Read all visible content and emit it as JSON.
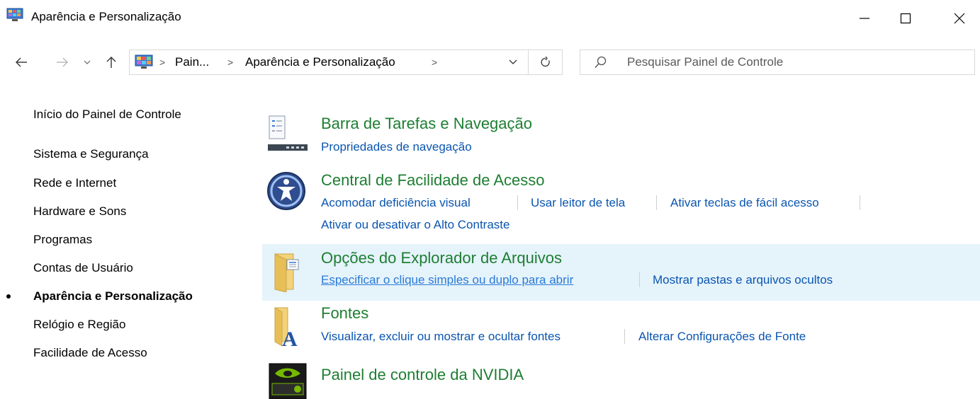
{
  "window": {
    "title": "Aparência e Personalização",
    "controls": [
      "minimize",
      "maximize",
      "close"
    ]
  },
  "navigation": {
    "breadcrumbs": [
      "Pain...",
      "Aparência e Personalização"
    ],
    "search_placeholder": "Pesquisar Painel de Controle",
    "search_value": ""
  },
  "sidebar": {
    "home": "Início do Painel de Controle",
    "items": [
      {
        "label": "Sistema e Segurança",
        "active": false
      },
      {
        "label": "Rede e Internet",
        "active": false
      },
      {
        "label": "Hardware e Sons",
        "active": false
      },
      {
        "label": "Programas",
        "active": false
      },
      {
        "label": "Contas de Usuário",
        "active": false
      },
      {
        "label": "Aparência e Personalização",
        "active": true
      },
      {
        "label": "Relógio e Região",
        "active": false
      },
      {
        "label": "Facilidade de Acesso",
        "active": false
      }
    ]
  },
  "categories": [
    {
      "title": "Barra de Tarefas e Navegação",
      "icon": "taskbar-icon",
      "links": [
        "Propriedades de navegação"
      ]
    },
    {
      "title": "Central de Facilidade de Acesso",
      "icon": "ease-of-access-icon",
      "links": [
        "Acomodar deficiência visual",
        "Usar leitor de tela",
        "Ativar teclas de fácil acesso",
        "Ativar ou desativar o Alto Contraste"
      ]
    },
    {
      "title": "Opções do Explorador de Arquivos",
      "icon": "folder-options-icon",
      "links": [
        "Especificar o clique simples ou duplo para abrir",
        "Mostrar pastas e arquivos ocultos"
      ]
    },
    {
      "title": "Fontes",
      "icon": "fonts-icon",
      "links": [
        "Visualizar, excluir ou mostrar e ocultar fontes",
        "Alterar Configurações de Fonte"
      ]
    },
    {
      "title": "Painel de controle da NVIDIA",
      "icon": "nvidia-icon",
      "links": []
    }
  ],
  "colors": {
    "category_title": "#1e7e32",
    "link": "#0a55b0",
    "hover_background": "#e5f3fb"
  }
}
